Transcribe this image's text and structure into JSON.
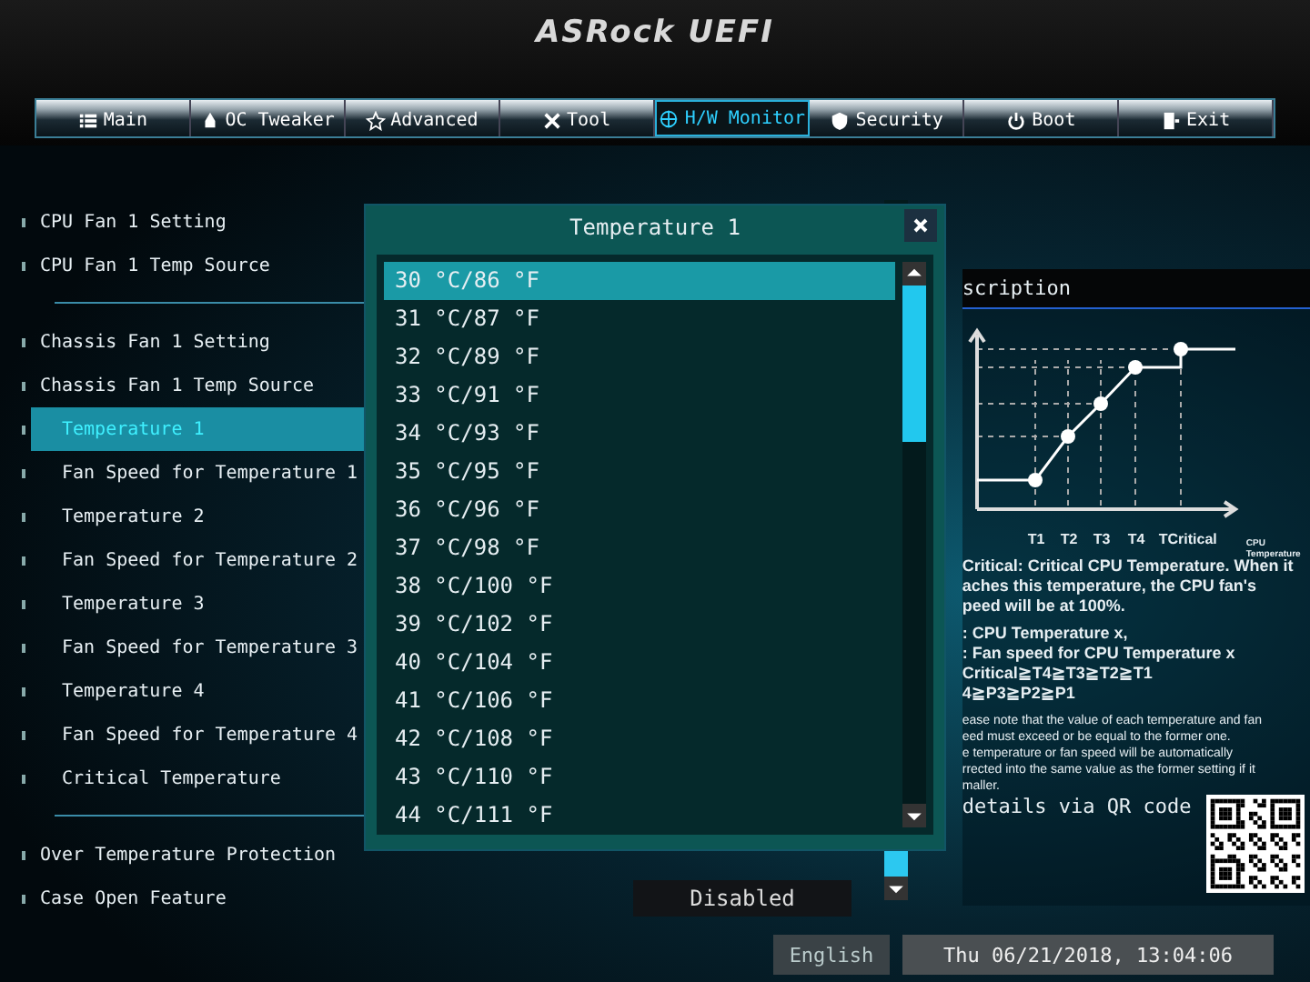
{
  "header": {
    "logo": "ASRock UEFI"
  },
  "tabs": [
    {
      "label": "Main",
      "selected": false
    },
    {
      "label": "OC Tweaker",
      "selected": false
    },
    {
      "label": "Advanced",
      "selected": false
    },
    {
      "label": "Tool",
      "selected": false
    },
    {
      "label": "H/W Monitor",
      "selected": true
    },
    {
      "label": "Security",
      "selected": false
    },
    {
      "label": "Boot",
      "selected": false
    },
    {
      "label": "Exit",
      "selected": false
    }
  ],
  "setting_groups": [
    [
      {
        "label": "CPU Fan 1 Setting",
        "selected": false
      },
      {
        "label": "CPU Fan 1 Temp Source",
        "selected": false
      }
    ],
    [
      {
        "label": "Chassis Fan 1 Setting",
        "selected": false
      },
      {
        "label": "Chassis Fan 1 Temp Source",
        "selected": false,
        "children": [
          {
            "label": "Temperature 1",
            "selected": true
          },
          {
            "label": "Fan Speed for Temperature 1",
            "selected": false
          },
          {
            "label": "Temperature 2",
            "selected": false
          },
          {
            "label": "Fan Speed for Temperature 2",
            "selected": false
          },
          {
            "label": "Temperature 3",
            "selected": false
          },
          {
            "label": "Fan Speed for Temperature 3",
            "selected": false
          },
          {
            "label": "Temperature 4",
            "selected": false
          },
          {
            "label": "Fan Speed for Temperature 4",
            "selected": false
          },
          {
            "label": "Critical Temperature",
            "selected": false
          }
        ]
      }
    ],
    [
      {
        "label": "Over Temperature Protection",
        "selected": false
      },
      {
        "label": "Case Open Feature",
        "selected": false,
        "value": "Disabled"
      }
    ]
  ],
  "modal": {
    "title": "Temperature 1",
    "options": [
      {
        "label": "30 °C/86 °F",
        "selected": true
      },
      {
        "label": "31 °C/87 °F",
        "selected": false
      },
      {
        "label": "32 °C/89 °F",
        "selected": false
      },
      {
        "label": "33 °C/91 °F",
        "selected": false
      },
      {
        "label": "34 °C/93 °F",
        "selected": false
      },
      {
        "label": "35 °C/95 °F",
        "selected": false
      },
      {
        "label": "36 °C/96 °F",
        "selected": false
      },
      {
        "label": "37 °C/98 °F",
        "selected": false
      },
      {
        "label": "38 °C/100 °F",
        "selected": false
      },
      {
        "label": "39 °C/102 °F",
        "selected": false
      },
      {
        "label": "40 °C/104 °F",
        "selected": false
      },
      {
        "label": "41 °C/106 °F",
        "selected": false
      },
      {
        "label": "42 °C/108 °F",
        "selected": false
      },
      {
        "label": "43 °C/110 °F",
        "selected": false
      },
      {
        "label": "44 °C/111 °F",
        "selected": false
      }
    ]
  },
  "description": {
    "title": "scription",
    "chart_labels": [
      "T1",
      "T2",
      "T3",
      "T4",
      "TCritical"
    ],
    "axis_label": "CPU Temperature",
    "paragraphs": [
      [
        "Critical: Critical CPU Temperature. When it",
        "aches this temperature, the CPU fan's",
        "peed will be at 100%."
      ],
      [
        ": CPU Temperature x,",
        ": Fan speed for CPU Temperature x",
        "Critical≧T4≧T3≧T2≧T1",
        "4≧P3≧P2≧P1"
      ]
    ],
    "note": [
      "ease note that the value of each temperature and fan",
      "eed must exceed or be equal to the former one.",
      "e temperature or fan speed will be automatically",
      "rrected into the same value as the former setting if it",
      "maller."
    ],
    "qr_text": "details via QR code"
  },
  "status_bar": {
    "language": "English",
    "datetime": "Thu 06/21/2018, 13:04:06"
  }
}
